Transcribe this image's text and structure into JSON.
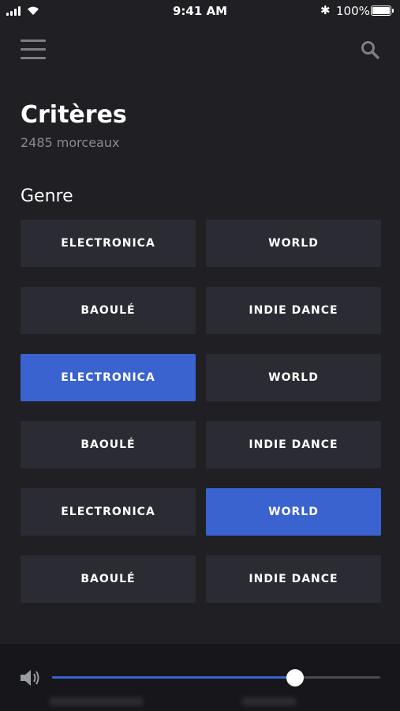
{
  "status_bar": {
    "time": "9:41 AM",
    "battery_text": "100%",
    "bluetooth_glyph": "✱",
    "icons": [
      "signal-icon",
      "wifi-icon",
      "bluetooth-icon",
      "battery-icon"
    ]
  },
  "header": {
    "menu_icon": "hamburger-menu-icon",
    "search_icon": "search-icon",
    "title": "Critères",
    "subtitle": "2485 morceaux"
  },
  "section": {
    "title": "Genre"
  },
  "genres": [
    {
      "label": "ELECTRONICA",
      "selected": false
    },
    {
      "label": "WORLD",
      "selected": false
    },
    {
      "label": "BAOULÉ",
      "selected": false
    },
    {
      "label": "INDIE DANCE",
      "selected": false
    },
    {
      "label": "ELECTRONICA",
      "selected": true
    },
    {
      "label": "WORLD",
      "selected": false
    },
    {
      "label": "BAOULÉ",
      "selected": false
    },
    {
      "label": "INDIE DANCE",
      "selected": false
    },
    {
      "label": "ELECTRONICA",
      "selected": false
    },
    {
      "label": "WORLD",
      "selected": true
    },
    {
      "label": "BAOULÉ",
      "selected": false
    },
    {
      "label": "INDIE DANCE",
      "selected": false
    }
  ],
  "player": {
    "volume_icon": "volume-icon",
    "volume_level": 0.74
  },
  "colors": {
    "background": "#1f1f24",
    "chip": "#2b2c33",
    "accent": "#3a63d0",
    "muted_text": "#8a8c93"
  }
}
